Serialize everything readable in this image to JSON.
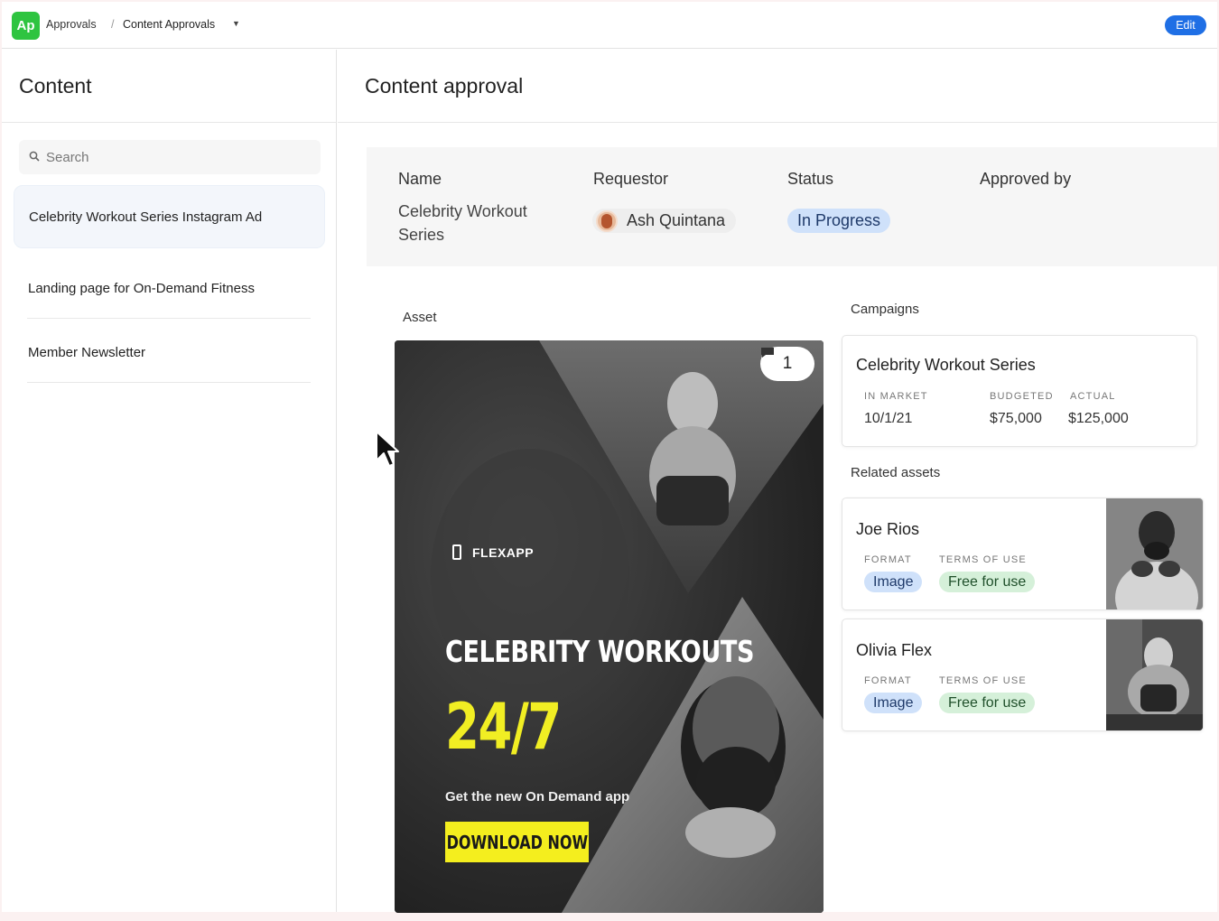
{
  "topbar": {
    "logo_text": "Ap",
    "breadcrumb_root": "Approvals",
    "breadcrumb_separator": "/",
    "breadcrumb_current": "Content Approvals",
    "breadcrumb_caret": "▼",
    "edit_label": "Edit"
  },
  "sidebar": {
    "title": "Content",
    "search_placeholder": "Search",
    "items": [
      {
        "label": "Celebrity Workout Series Instagram Ad",
        "selected": true
      },
      {
        "label": "Landing page for On-Demand Fitness",
        "selected": false
      },
      {
        "label": "Member Newsletter",
        "selected": false
      }
    ]
  },
  "main": {
    "title": "Content approval",
    "summary": {
      "name_label": "Name",
      "name_value": "Celebrity Workout Series",
      "requestor_label": "Requestor",
      "requestor_value": "Ash Quintana",
      "status_label": "Status",
      "status_value": "In Progress",
      "approved_by_label": "Approved by"
    },
    "asset": {
      "label": "Asset",
      "comment_count": "1",
      "brand": "FLEXAPP",
      "headline": "CELEBRITY WORKOUTS",
      "big_text": "24/7",
      "tagline": "Get the new On Demand app",
      "cta_label": "DOWNLOAD NOW"
    },
    "campaigns": {
      "label": "Campaigns",
      "card": {
        "title": "Celebrity Workout Series",
        "in_market_label": "IN MARKET",
        "in_market_value": "10/1/21",
        "budgeted_label": "BUDGETED",
        "budgeted_value": "$75,000",
        "actual_label": "ACTUAL",
        "actual_value": "$125,000"
      }
    },
    "related_assets": {
      "label": "Related assets",
      "items": [
        {
          "name": "Joe Rios",
          "format_label": "FORMAT",
          "format_value": "Image",
          "terms_label": "TERMS OF USE",
          "terms_value": "Free for use"
        },
        {
          "name": "Olivia Flex",
          "format_label": "FORMAT",
          "format_value": "Image",
          "terms_label": "TERMS OF USE",
          "terms_value": "Free for use"
        }
      ]
    }
  },
  "colors": {
    "brand_green": "#2ec440",
    "edit_blue": "#1f6fe5",
    "status_blue_bg": "#cfe1fa",
    "terms_green_bg": "#d5f0d9",
    "ad_yellow": "#f1ee23"
  }
}
